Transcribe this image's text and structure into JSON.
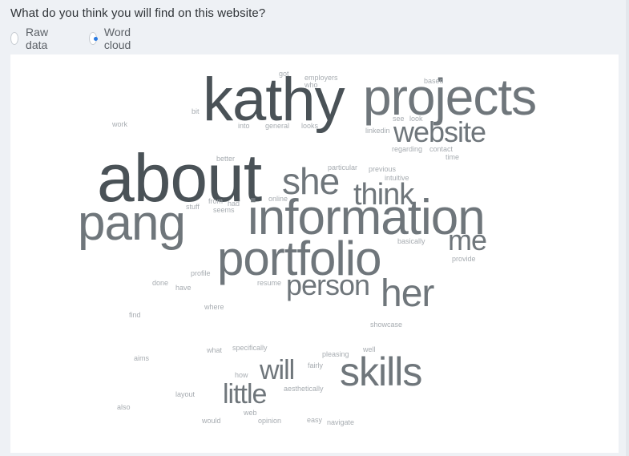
{
  "question": "What do you think you will find on this website?",
  "view_toggle": {
    "options": [
      {
        "label": "Raw data",
        "selected": false
      },
      {
        "label": "Word cloud",
        "selected": true
      }
    ]
  },
  "colors": {
    "accent": "#2a7ae2",
    "word_dark": "#4a5257",
    "word_mid": "#6f767b",
    "word_light": "#a7acb1"
  },
  "word_cloud": {
    "words": [
      {
        "text": "about",
        "tone": "dark"
      },
      {
        "text": "kathy",
        "tone": "dark"
      },
      {
        "text": "projects",
        "tone": "mid"
      },
      {
        "text": "information",
        "tone": "mid"
      },
      {
        "text": "pang",
        "tone": "mid"
      },
      {
        "text": "portfolio",
        "tone": "mid"
      },
      {
        "text": "website",
        "tone": "mid"
      },
      {
        "text": "she",
        "tone": "mid"
      },
      {
        "text": "think",
        "tone": "mid"
      },
      {
        "text": "her",
        "tone": "mid"
      },
      {
        "text": "person",
        "tone": "mid"
      },
      {
        "text": "me",
        "tone": "mid"
      },
      {
        "text": "skills",
        "tone": "mid"
      },
      {
        "text": "will",
        "tone": "mid"
      },
      {
        "text": "little",
        "tone": "mid"
      },
      {
        "text": "got",
        "tone": "light"
      },
      {
        "text": "employers",
        "tone": "light"
      },
      {
        "text": "who",
        "tone": "light"
      },
      {
        "text": "based",
        "tone": "light"
      },
      {
        "text": "bit",
        "tone": "light"
      },
      {
        "text": "work",
        "tone": "light"
      },
      {
        "text": "into",
        "tone": "light"
      },
      {
        "text": "general",
        "tone": "light"
      },
      {
        "text": "looks",
        "tone": "light"
      },
      {
        "text": "see",
        "tone": "light"
      },
      {
        "text": "look",
        "tone": "light"
      },
      {
        "text": "linkedin",
        "tone": "light"
      },
      {
        "text": "regarding",
        "tone": "light"
      },
      {
        "text": "contact",
        "tone": "light"
      },
      {
        "text": "time",
        "tone": "light"
      },
      {
        "text": "better",
        "tone": "light"
      },
      {
        "text": "particular",
        "tone": "light"
      },
      {
        "text": "previous",
        "tone": "light"
      },
      {
        "text": "intuitive",
        "tone": "light"
      },
      {
        "text": "online",
        "tone": "light"
      },
      {
        "text": "stuff",
        "tone": "light"
      },
      {
        "text": "from",
        "tone": "light"
      },
      {
        "text": "had",
        "tone": "light"
      },
      {
        "text": "seems",
        "tone": "light"
      },
      {
        "text": "basically",
        "tone": "light"
      },
      {
        "text": "provide",
        "tone": "light"
      },
      {
        "text": "profile",
        "tone": "light"
      },
      {
        "text": "done",
        "tone": "light"
      },
      {
        "text": "have",
        "tone": "light"
      },
      {
        "text": "resume",
        "tone": "light"
      },
      {
        "text": "where",
        "tone": "light"
      },
      {
        "text": "find",
        "tone": "light"
      },
      {
        "text": "showcase",
        "tone": "light"
      },
      {
        "text": "what",
        "tone": "light"
      },
      {
        "text": "specifically",
        "tone": "light"
      },
      {
        "text": "pleasing",
        "tone": "light"
      },
      {
        "text": "well",
        "tone": "light"
      },
      {
        "text": "aims",
        "tone": "light"
      },
      {
        "text": "how",
        "tone": "light"
      },
      {
        "text": "fairly",
        "tone": "light"
      },
      {
        "text": "aesthetically",
        "tone": "light"
      },
      {
        "text": "layout",
        "tone": "light"
      },
      {
        "text": "also",
        "tone": "light"
      },
      {
        "text": "web",
        "tone": "light"
      },
      {
        "text": "would",
        "tone": "light"
      },
      {
        "text": "opinion",
        "tone": "light"
      },
      {
        "text": "easy",
        "tone": "light"
      },
      {
        "text": "navigate",
        "tone": "light"
      }
    ]
  }
}
